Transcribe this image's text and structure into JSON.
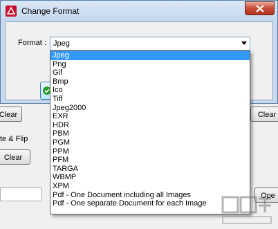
{
  "background": {
    "clear_left": "Clear",
    "clear_right": "Clear",
    "rotate_label": "te & Flip",
    "clear_button": "Clear",
    "open_button": "Ope"
  },
  "dialog": {
    "title": "Change Format",
    "format_label": "Format :",
    "format_value": "Jpeg"
  },
  "dropdown": {
    "options": [
      "Jpeg",
      "Png",
      "Gif",
      "Bmp",
      "Ico",
      "Tiff",
      "Jpeg2000",
      "EXR",
      "HDR",
      "PBM",
      "PGM",
      "PPM",
      "PFM",
      "TARGA",
      "WBMP",
      "XPM",
      "Pdf - One Document including all Images",
      "Pdf - One separate Document for each Image"
    ],
    "selected_index": 0
  },
  "colors": {
    "selection": "#3399ff",
    "close_button": "#c7503a",
    "title_gradient_top": "#dbe8f6"
  }
}
